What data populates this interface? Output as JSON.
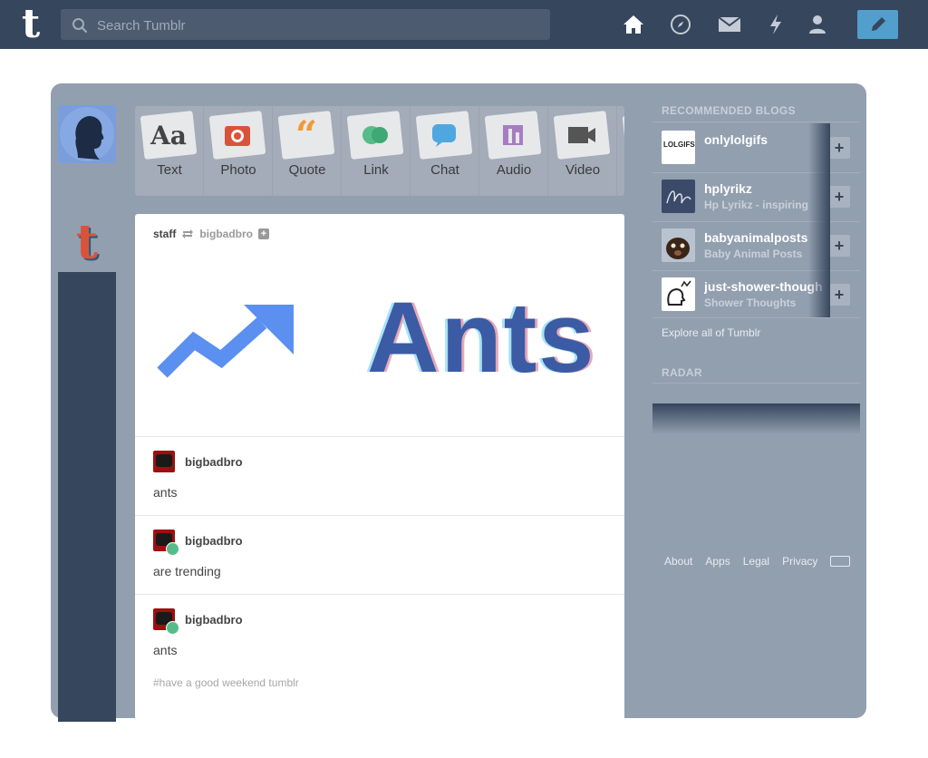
{
  "header": {
    "logo_letter": "t",
    "search_placeholder": "Search Tumblr",
    "nav_icons": [
      "home-icon",
      "compass-icon",
      "mail-icon",
      "lightning-icon",
      "account-icon"
    ],
    "compose_icon": "pencil-icon"
  },
  "post_types": [
    {
      "label": "Text",
      "icon": "text-icon"
    },
    {
      "label": "Photo",
      "icon": "photo-icon"
    },
    {
      "label": "Quote",
      "icon": "quote-icon"
    },
    {
      "label": "Link",
      "icon": "link-icon"
    },
    {
      "label": "Chat",
      "icon": "chat-icon"
    },
    {
      "label": "Audio",
      "icon": "audio-icon"
    },
    {
      "label": "Video",
      "icon": "video-icon"
    }
  ],
  "post": {
    "author": "staff",
    "reblogged_from": "bigbadbro",
    "image_text": "Ants",
    "replies": [
      {
        "name": "bigbadbro",
        "text": "ants"
      },
      {
        "name": "bigbadbro",
        "text": "are trending"
      },
      {
        "name": "bigbadbro",
        "text": "ants"
      }
    ],
    "tags": "#have a good weekend tumblr"
  },
  "sidebar": {
    "recommended_title": "RECOMMENDED BLOGS",
    "blogs": [
      {
        "name": "onlylolgifs",
        "subtitle": "",
        "avatar_text": "LOLGIFS.NET"
      },
      {
        "name": "hplyrikz",
        "subtitle": "Hp Lyrikz - inspiring"
      },
      {
        "name": "babyanimalposts",
        "subtitle": "Baby Animal Posts"
      },
      {
        "name": "just-shower-thoughts",
        "subtitle": "Shower Thoughts"
      }
    ],
    "explore_link": "Explore all of Tumblr",
    "radar_title": "RADAR",
    "footer_links": [
      "About",
      "Apps",
      "Legal",
      "Privacy"
    ]
  },
  "colors": {
    "header_bg": "#36465d",
    "main_bg": "#929faf",
    "accent": "#529ecc"
  }
}
